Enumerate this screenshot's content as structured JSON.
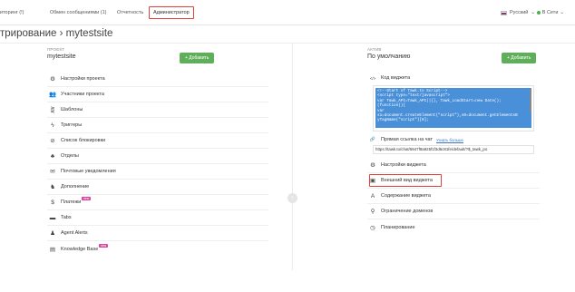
{
  "topnav": {
    "items": [
      {
        "label": "иторинг (!)"
      },
      {
        "label": "Обмен сообщениями (1)"
      },
      {
        "label": "Отчетность"
      },
      {
        "label": "Администратор"
      }
    ],
    "language": "Русский",
    "language_chevron": "⌄",
    "status": "В Сети",
    "status_chevron": "⌄"
  },
  "page": {
    "title": "трирование › mytestsite"
  },
  "left": {
    "section_label": "ПРОЕКТ",
    "project_name": "mytestsite",
    "add_label": "+ Добавить",
    "items": [
      {
        "icon": "⚙",
        "icon_name": "gear-icon",
        "label": "Настройки проекта"
      },
      {
        "icon": "👥",
        "icon_name": "members-icon",
        "label": "Участники проекта"
      },
      {
        "icon": "⋛",
        "icon_name": "shortcuts-icon",
        "label": "Шаблоны"
      },
      {
        "icon": "ϟ",
        "icon_name": "triggers-icon",
        "label": "Триггеры"
      },
      {
        "icon": "⊘",
        "icon_name": "ban-icon",
        "label": "Список блокировки"
      },
      {
        "icon": "♣",
        "icon_name": "departments-icon",
        "label": "Отделы"
      },
      {
        "icon": "✉",
        "icon_name": "mail-icon",
        "label": "Почтовые уведомления"
      },
      {
        "icon": "♞",
        "icon_name": "addons-icon",
        "label": "Дополнение"
      },
      {
        "icon": "$",
        "icon_name": "dollar-icon",
        "label": "Платежи",
        "badge": "new"
      },
      {
        "icon": "▬",
        "icon_name": "tabs-icon",
        "label": "Tabs"
      },
      {
        "icon": "♟",
        "icon_name": "agent-icon",
        "label": "Agent Alerts"
      },
      {
        "icon": "▤",
        "icon_name": "book-icon",
        "label": "Knowledge Base",
        "badge": "new"
      }
    ]
  },
  "right": {
    "section_label": "АКТИВ",
    "widget_name": "По умолчанию",
    "add_label": "+ Добавить",
    "code_label": "Код виджета",
    "code_text": "<!--Start of Tawk.to Script-->\n<script type=\"text/javascript\">\nvar Tawk_API=Tawk_API||{}, Tawk_LoadStart=new Date();\n(function(){\nvar\ns1=document.createElement(\"script\"),s0=document.getElementsB\nyTagName(\"script\")[0];",
    "link_label": "Прямая ссылка на чат",
    "link_help": "Узнать больше",
    "link_value": "https://tawk.to/chat/5947f8a925f1f3d6c81fe/default/?$_tawk_po",
    "items": [
      {
        "icon": "⚙",
        "icon_name": "gear-icon",
        "label": "Настройки виджета"
      },
      {
        "icon": "▣",
        "icon_name": "image-icon",
        "label": "Внешний вид виджета"
      },
      {
        "icon": "A",
        "icon_name": "text-icon",
        "label": "Содержание виджета"
      },
      {
        "icon": "⚲",
        "icon_name": "domain-icon",
        "label": "Ограничение доменов"
      },
      {
        "icon": "◷",
        "icon_name": "clock-icon",
        "label": "Планирование"
      }
    ]
  },
  "collapse_icon": "›",
  "code_icon": "</>",
  "link_icon": "🔗"
}
